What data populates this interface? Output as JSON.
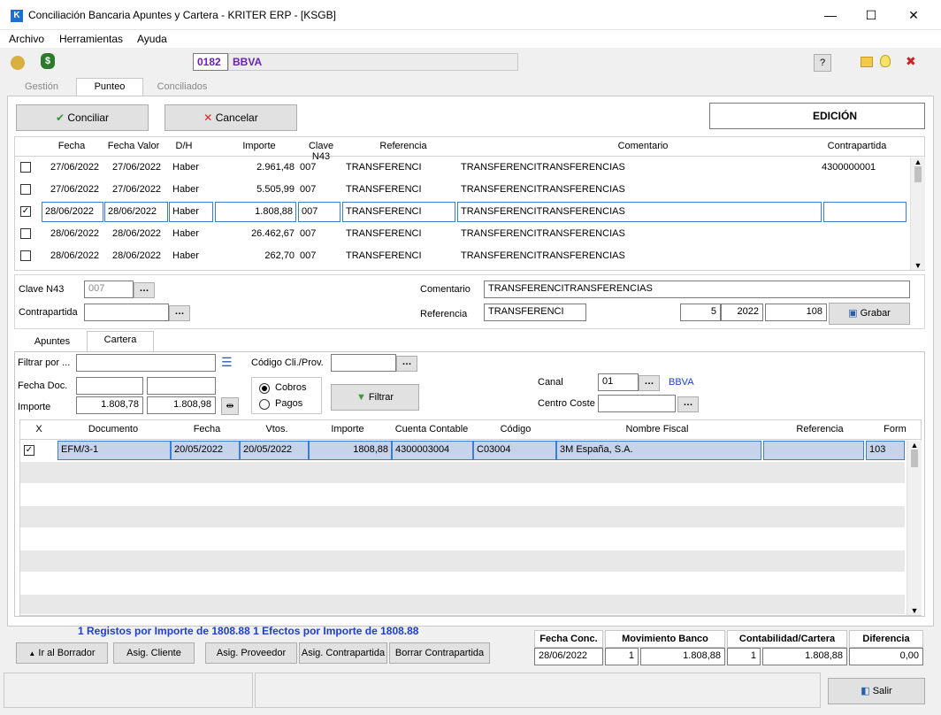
{
  "window": {
    "title": "Conciliación Bancaria Apuntes y Cartera - KRITER ERP - [KSGB]",
    "app_icon": "K",
    "minimize": "—",
    "maximize": "☐",
    "close": "✕"
  },
  "menu": [
    "Archivo",
    "Herramientas",
    "Ayuda"
  ],
  "toolbar": {
    "bank_code": "0182",
    "bank_name": "BBVA",
    "help": "?"
  },
  "tabs": [
    "Gestión",
    "Punteo",
    "Conciliados"
  ],
  "actions": {
    "conciliar": "Conciliar",
    "cancelar": "Cancelar",
    "mode": "EDICIÓN"
  },
  "grid": {
    "headers": [
      "Fecha",
      "Fecha Valor",
      "D/H",
      "Importe",
      "Clave N43",
      "Referencia",
      "Comentario",
      "Contrapartida"
    ],
    "rows": [
      {
        "checked": false,
        "fecha": "27/06/2022",
        "valor": "27/06/2022",
        "dh": "Haber",
        "importe": "2.961,48",
        "clave": "007",
        "ref": "TRANSFERENCI",
        "comentario": "TRANSFERENCITRANSFERENCIAS",
        "contra": "4300000001"
      },
      {
        "checked": false,
        "fecha": "27/06/2022",
        "valor": "27/06/2022",
        "dh": "Haber",
        "importe": "5.505,99",
        "clave": "007",
        "ref": "TRANSFERENCI",
        "comentario": "TRANSFERENCITRANSFERENCIAS",
        "contra": ""
      },
      {
        "checked": true,
        "fecha": "28/06/2022",
        "valor": "28/06/2022",
        "dh": "Haber",
        "importe": "1.808,88",
        "clave": "007",
        "ref": "TRANSFERENCI",
        "comentario": "TRANSFERENCITRANSFERENCIAS",
        "contra": ""
      },
      {
        "checked": false,
        "fecha": "28/06/2022",
        "valor": "28/06/2022",
        "dh": "Haber",
        "importe": "26.462,67",
        "clave": "007",
        "ref": "TRANSFERENCI",
        "comentario": "TRANSFERENCITRANSFERENCIAS",
        "contra": ""
      },
      {
        "checked": false,
        "fecha": "28/06/2022",
        "valor": "28/06/2022",
        "dh": "Haber",
        "importe": "262,70",
        "clave": "007",
        "ref": "TRANSFERENCI",
        "comentario": "TRANSFERENCITRANSFERENCIAS",
        "contra": ""
      }
    ]
  },
  "detail": {
    "clave_label": "Clave N43",
    "clave_value": "007",
    "contra_label": "Contrapartida",
    "contra_value": "",
    "comentario_label": "Comentario",
    "comentario_value": "TRANSFERENCITRANSFERENCIAS",
    "referencia_label": "Referencia",
    "referencia_value": "TRANSFERENCI",
    "num1": "5",
    "year": "2022",
    "num2": "108",
    "grabar": "Grabar"
  },
  "subtabs": [
    "Apuntes",
    "Cartera"
  ],
  "filter": {
    "filtrar_label": "Filtrar por ...",
    "filtrar_value": "",
    "fecha_label": "Fecha Doc.",
    "fecha_from": "",
    "fecha_to": "",
    "importe_label": "Importe",
    "importe_from": "1.808,78",
    "importe_to": "1.808,98",
    "codigo_label": "Código Cli./Prov.",
    "codigo_value": "",
    "cobros": "Cobros",
    "pagos": "Pagos",
    "filtrar_btn": "Filtrar",
    "canal_label": "Canal",
    "canal_value": "01",
    "canal_name": "BBVA",
    "centro_label": "Centro Coste",
    "centro_value": ""
  },
  "cartera": {
    "headers": [
      "X",
      "Documento",
      "Fecha",
      "Vtos.",
      "Importe",
      "Cuenta Contable",
      "Código",
      "Nombre Fiscal",
      "Referencia",
      "Form"
    ],
    "rows": [
      {
        "checked": true,
        "documento": "EFM/3-1",
        "fecha": "20/05/2022",
        "vtos": "20/05/2022",
        "importe": "1808,88",
        "cuenta": "4300003004",
        "codigo": "C03004",
        "nombre": "3M España, S.A.",
        "referencia": "",
        "form": "103"
      }
    ]
  },
  "summary_text": "1 Registos por Importe de 1808.88 1 Efectos por Importe de 1808.88",
  "bottom_buttons": {
    "borrador": "Ir al Borrador",
    "cliente": "Asig. Cliente",
    "proveedor": "Asig. Proveedor",
    "contrapartida": "Asig. Contrapartida",
    "borrar": "Borrar Contrapartida"
  },
  "totals": {
    "fecha_conc_label": "Fecha Conc.",
    "fecha_conc": "28/06/2022",
    "mov_label": "Movimiento Banco",
    "mov_count": "1",
    "mov_amount": "1.808,88",
    "cont_label": "Contabilidad/Cartera",
    "cont_count": "1",
    "cont_amount": "1.808,88",
    "dif_label": "Diferencia",
    "dif_amount": "0,00"
  },
  "status": {
    "salir": "Salir"
  }
}
